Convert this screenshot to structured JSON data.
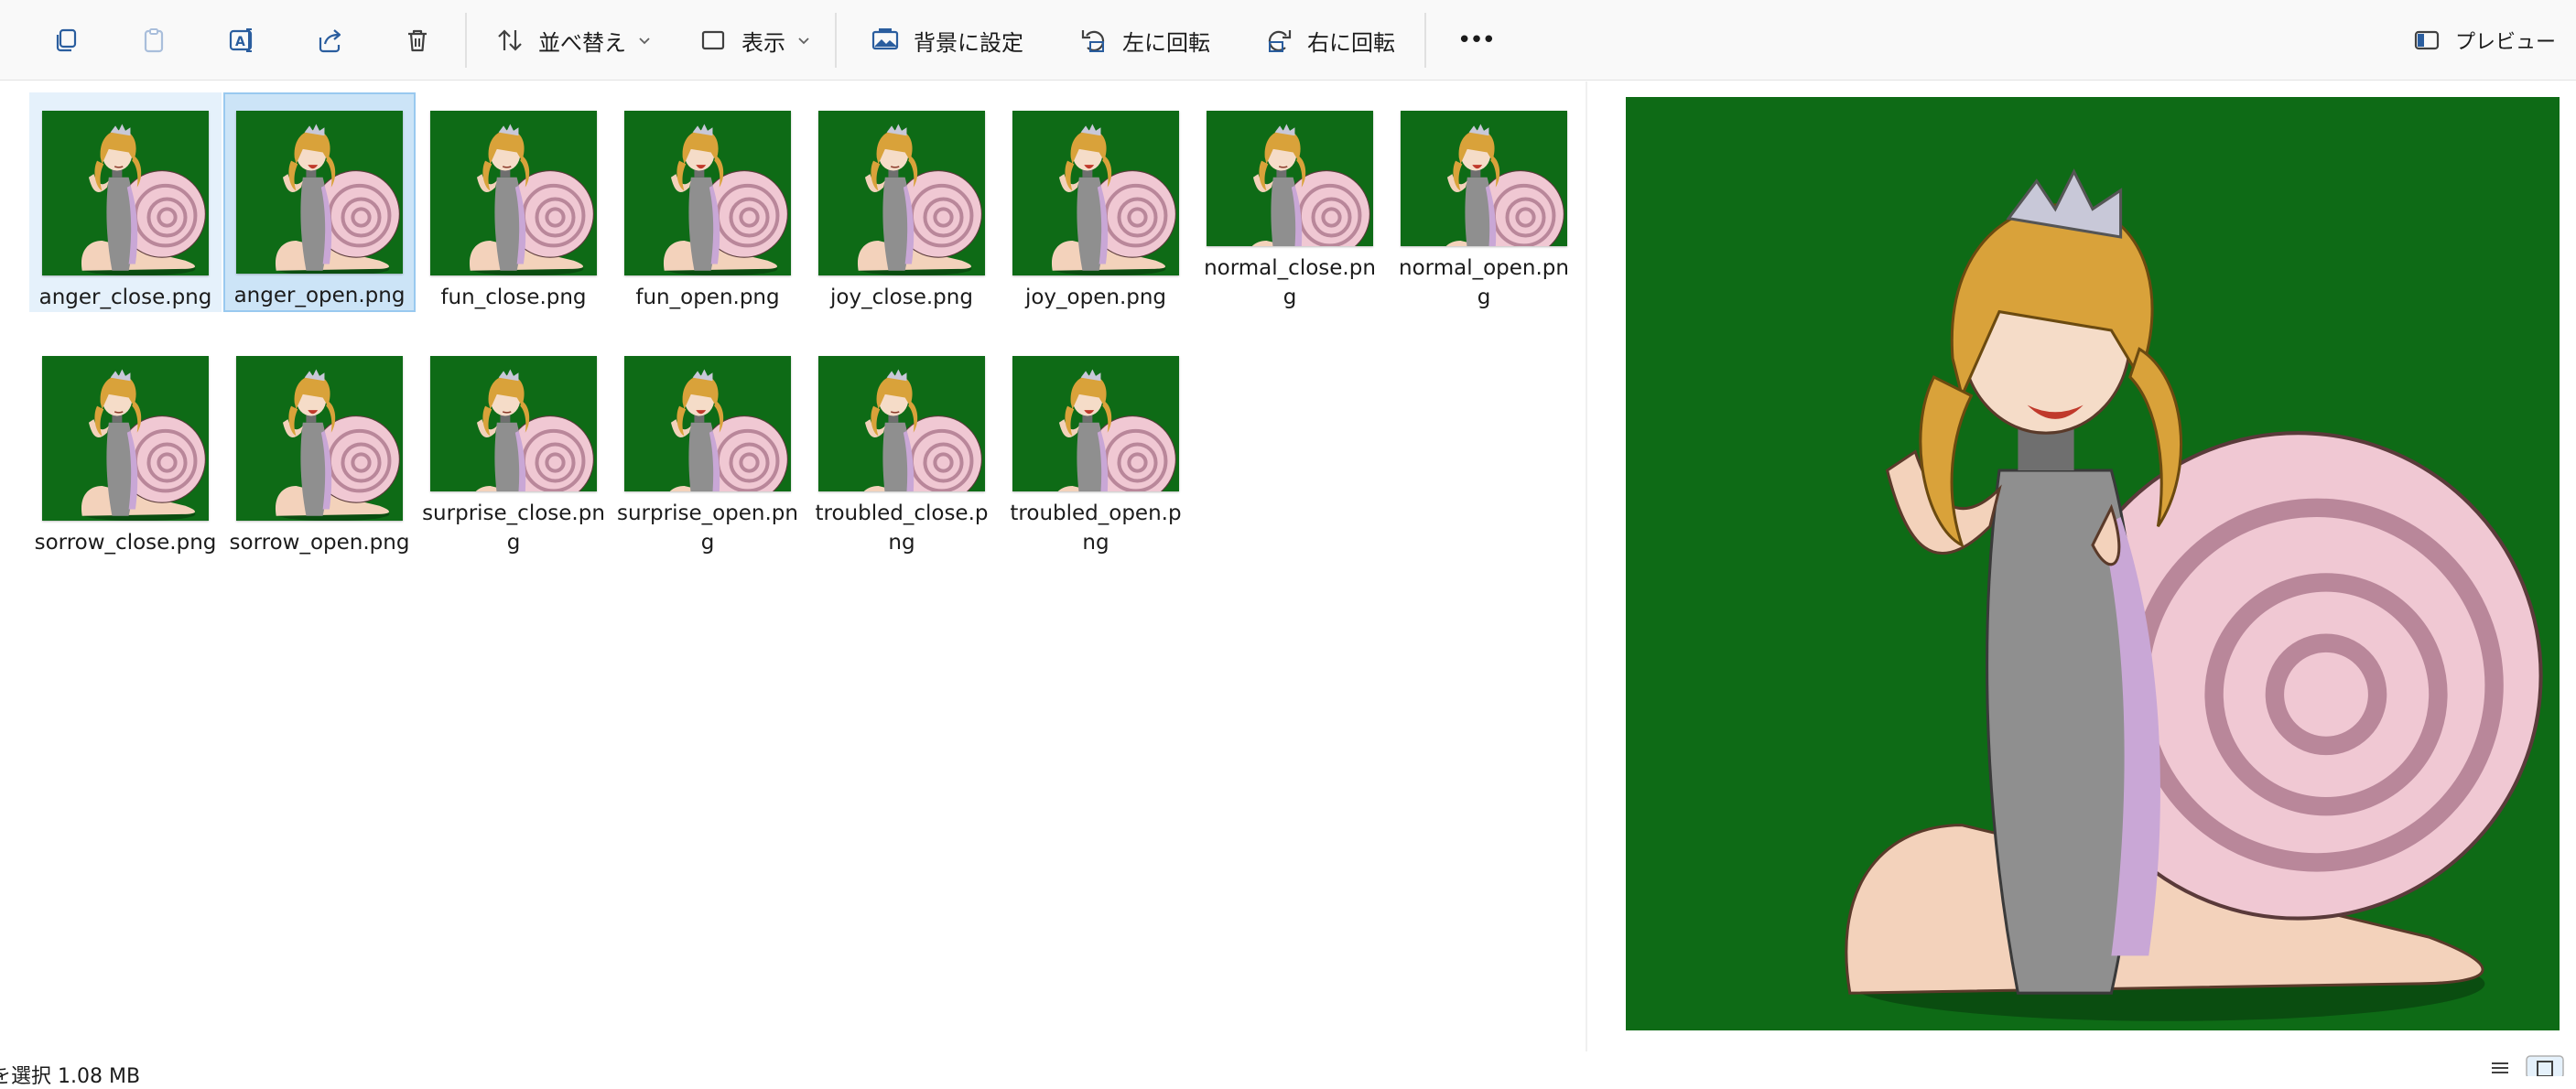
{
  "toolbar": {
    "icons": [
      "copy-icon",
      "paste-icon",
      "rename-icon",
      "share-icon",
      "delete-icon"
    ],
    "sort_label": "並べ替え",
    "view_label": "表示",
    "set_background_label": "背景に設定",
    "rotate_left_label": "左に回転",
    "rotate_right_label": "右に回転",
    "more_label": "•••",
    "preview_label": "プレビュー"
  },
  "files": [
    {
      "name": "anger_close.png",
      "mouth": "closed",
      "state": "hover"
    },
    {
      "name": "anger_open.png",
      "mouth": "open",
      "state": "selected"
    },
    {
      "name": "fun_close.png",
      "mouth": "closed",
      "state": ""
    },
    {
      "name": "fun_open.png",
      "mouth": "open",
      "state": ""
    },
    {
      "name": "joy_close.png",
      "mouth": "closed",
      "state": ""
    },
    {
      "name": "joy_open.png",
      "mouth": "open",
      "state": ""
    },
    {
      "name": "normal_close.png",
      "mouth": "closed",
      "state": ""
    },
    {
      "name": "normal_open.png",
      "mouth": "open",
      "state": ""
    },
    {
      "name": "sorrow_close.png",
      "mouth": "closed",
      "state": ""
    },
    {
      "name": "sorrow_open.png",
      "mouth": "open",
      "state": ""
    },
    {
      "name": "surprise_close.png",
      "mouth": "closed",
      "state": ""
    },
    {
      "name": "surprise_open.png",
      "mouth": "open",
      "state": ""
    },
    {
      "name": "troubled_close.png",
      "mouth": "closed",
      "state": ""
    },
    {
      "name": "troubled_open.png",
      "mouth": "open",
      "state": ""
    }
  ],
  "status": {
    "text": "を選択  1.08 MB"
  },
  "colors": {
    "thumb_background": "#0e6b16",
    "selection_fill": "#cce4f7",
    "selection_border": "#99c9ef",
    "hover_fill": "#e5f1fb"
  }
}
